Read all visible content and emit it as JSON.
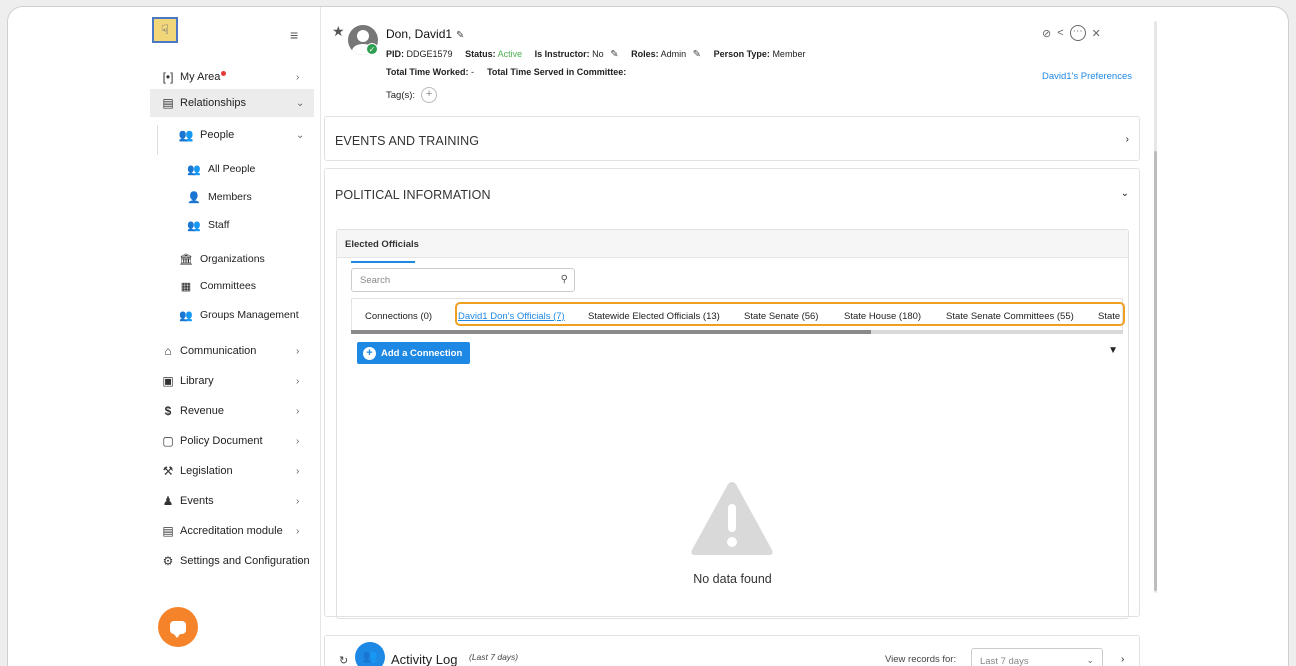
{
  "sidebar": {
    "logo_glyph": "☟",
    "menu_icon": "menu-icon",
    "my_area": "My Area",
    "relationships": "Relationships",
    "people": "People",
    "all_people": "All People",
    "members": "Members",
    "staff": "Staff",
    "organizations": "Organizations",
    "committees": "Committees",
    "groups_management": "Groups Management",
    "communication": "Communication",
    "library": "Library",
    "revenue": "Revenue",
    "policy_document": "Policy Document",
    "legislation": "Legislation",
    "events": "Events",
    "accreditation": "Accreditation module",
    "settings": "Settings and Configuration"
  },
  "header": {
    "name": "Don, David1",
    "pid_label": "PID:",
    "pid_value": "DDGE1579",
    "status_label": "Status:",
    "status_value": "Active",
    "instructor_label": "Is Instructor:",
    "instructor_value": "No",
    "roles_label": "Roles:",
    "roles_value": "Admin",
    "person_type_label": "Person Type:",
    "person_type_value": "Member",
    "time_worked_label": "Total Time Worked:",
    "time_worked_value": "-",
    "time_committee_label": "Total Time Served in Committee:",
    "tags_label": "Tag(s):",
    "preferences_link": "David1's Preferences"
  },
  "sections": {
    "events_training": "EVENTS AND TRAINING",
    "political_info": "POLITICAL INFORMATION",
    "elected_officials": "Elected Officials"
  },
  "search": {
    "placeholder": "Search"
  },
  "tabs": [
    {
      "label": "Connections (0)"
    },
    {
      "label": "David1 Don's Officials (7)"
    },
    {
      "label": "Statewide Elected Officials (13)"
    },
    {
      "label": "State Senate (56)"
    },
    {
      "label": "State House (180)"
    },
    {
      "label": "State Senate Committees (55)"
    },
    {
      "label": "State Hou"
    }
  ],
  "actions": {
    "add_connection": "Add a Connection"
  },
  "empty_state": "No data found",
  "activity": {
    "title": "Activity Log",
    "subtitle": "(Last 7 days)",
    "view_label": "View records for:",
    "view_value": "Last 7 days"
  },
  "colors": {
    "accent": "#1e88e5",
    "highlight": "#f0a020",
    "active": "#4caf50",
    "chat": "#f5832a"
  }
}
